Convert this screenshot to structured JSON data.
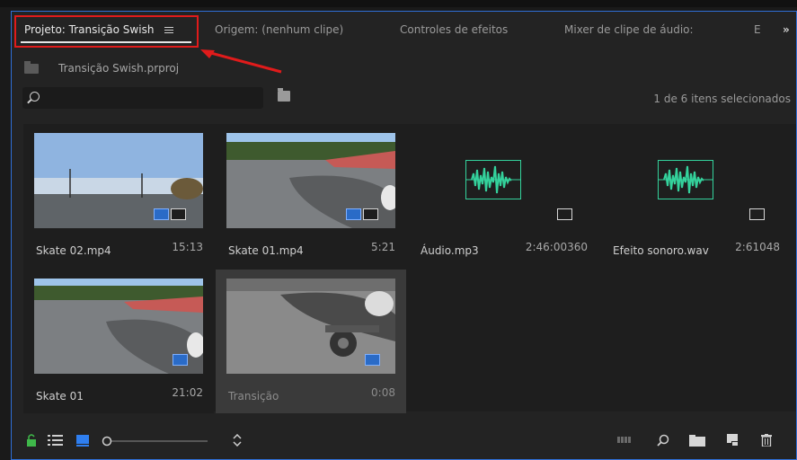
{
  "colors": {
    "accent_blue": "#2f6fd6",
    "highlight_red": "#e01b1b",
    "audio_green": "#34d29c"
  },
  "tabs": [
    {
      "label": "Projeto: Transição Swish",
      "active": true
    },
    {
      "label": "Origem: (nenhum clipe)"
    },
    {
      "label": "Controles de efeitos"
    },
    {
      "label": "Mixer de clipe de áudio:"
    },
    {
      "label": "E"
    }
  ],
  "overflow_label": "»",
  "project_file": "Transição Swish.prproj",
  "search": {
    "value": "",
    "placeholder": ""
  },
  "selection_count": "1 de 6 itens selecionados",
  "items": [
    {
      "name": "Skate 02.mp4",
      "duration": "15:13",
      "kind": "video"
    },
    {
      "name": "Skate 01.mp4",
      "duration": "5:21",
      "kind": "video"
    },
    {
      "name": "Áudio.mp3",
      "duration": "2:46:00360",
      "kind": "audio"
    },
    {
      "name": "Efeito sonoro.wav",
      "duration": "2:61048",
      "kind": "audio"
    },
    {
      "name": "Skate 01",
      "duration": "21:02",
      "kind": "sequence"
    },
    {
      "name": "Transição",
      "duration": "0:08",
      "kind": "sequence",
      "selected": true
    }
  ],
  "footer_icons": [
    "lock-icon",
    "list-view-icon",
    "icon-view-icon",
    "zoom-slider",
    "sort-icon",
    "automate-icon",
    "find-icon",
    "new-bin-icon",
    "new-item-icon",
    "trash-icon"
  ]
}
